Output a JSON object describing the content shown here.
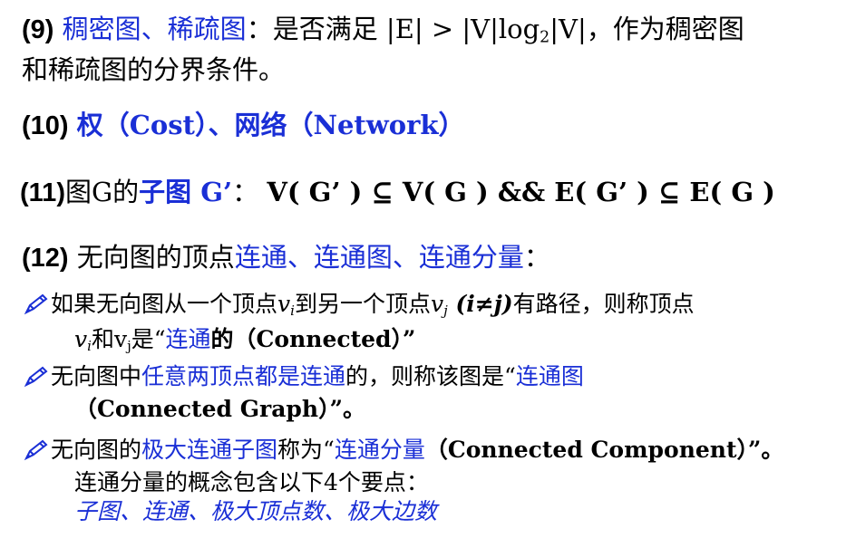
{
  "items": {
    "i9": {
      "num": "(9)",
      "term": "稠密图、稀疏图",
      "colon": "：",
      "pre": "是否满足 |E| > |V|log",
      "sub": "2",
      "post": "|V|，作为稠密图",
      "line2": "和稀疏图的分界条件。"
    },
    "i10": {
      "num": "(10)",
      "term": "权（Cost）、网络（Network）"
    },
    "i11": {
      "num": "(11)",
      "lead": "图G的",
      "term": "子图 G’",
      "colon": "：",
      "formula": "V( G’ ) ⊆ V( G )  &&  E( G’ ) ⊆ E( G )"
    },
    "i12": {
      "num": "(12)",
      "lead": "无向图的顶点",
      "term": "连通、连通图、连通分量",
      "colon": "："
    }
  },
  "bullets": {
    "b1": {
      "t1": "如果无向图从一个顶点",
      "vi": "v",
      "vi_sub": "i",
      "t2": "到另一个顶点",
      "vj": "v",
      "vj_sub": "j",
      "cond": " (i≠j)",
      "t3": "有路径，则称顶点",
      "l2_v1": "v",
      "l2_v1_sub": "i",
      "l2_and": "和v",
      "l2_v2_sub": "j",
      "l2_is": "是“",
      "l2_term": "连通",
      "l2_rest": "的（Connected）”"
    },
    "b2": {
      "t1": "无向图中",
      "term1": "任意两顶点都是连通",
      "t2": "的，则称该图是“",
      "term2": "连通图",
      "l2": "（Connected Graph）”。"
    },
    "b3": {
      "t1": "无向图的",
      "term1": "极大连通子图",
      "t2": "称为“",
      "term2": "连通分量",
      "t3": "（Connected Component）”。",
      "l2": "连通分量的概念包含以下4个要点：",
      "l3": "子图、连通、极大顶点数、极大边数"
    }
  },
  "icons": {
    "bullet": "pencil-icon"
  },
  "colors": {
    "accent": "#1a2fd6",
    "text": "#000000"
  }
}
